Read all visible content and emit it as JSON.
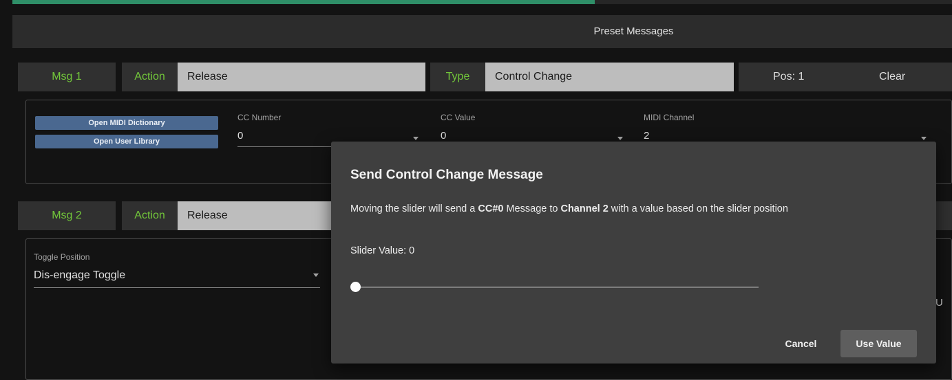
{
  "progress": {
    "fraction": 0.62
  },
  "header": {
    "title": "Preset Messages"
  },
  "msg1": {
    "label": "Msg 1",
    "action_label": "Action",
    "action_value": "Release",
    "type_label": "Type",
    "type_value": "Control Change",
    "pos": "Pos: 1",
    "clear": "Clear",
    "open_dictionary": "Open MIDI Dictionary",
    "open_library": "Open User Library",
    "cc_number_label": "CC Number",
    "cc_number_value": "0",
    "cc_value_label": "CC Value",
    "cc_value_value": "0",
    "midi_channel_label": "MIDI Channel",
    "midi_channel_value": "2"
  },
  "msg2": {
    "label": "Msg 2",
    "action_label": "Action",
    "action_value": "Release",
    "toggle_label": "Toggle Position",
    "toggle_value": "Dis-engage Toggle",
    "clipped_char": "U"
  },
  "dialog": {
    "title": "Send Control Change Message",
    "text_before_cc": "Moving the slider will send a ",
    "cc": "CC#0",
    "text_mid": " Message to ",
    "channel": "Channel 2",
    "text_after": " with a value based on the slider position",
    "slider_label": "Slider Value: 0",
    "slider_value": 0,
    "cancel": "Cancel",
    "use_value": "Use Value"
  }
}
